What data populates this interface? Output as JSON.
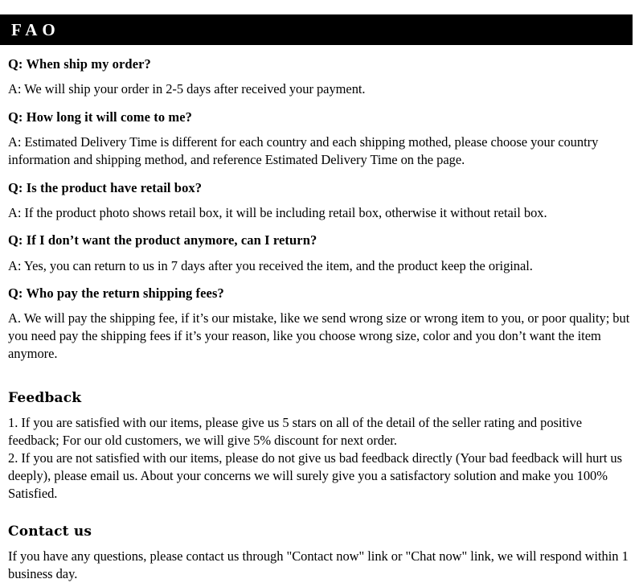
{
  "header": {
    "title": "FAO",
    "background_color": "#000000",
    "text_color": "#ffffff"
  },
  "faq": {
    "items": [
      {
        "question": "Q: When ship my order?",
        "answer": "A: We will ship your order in 2-5 days after received your payment."
      },
      {
        "question": "Q: How long it will come to me?",
        "answer": "A: Estimated Delivery Time is different for each country and each shipping mothed, please choose your country information and shipping method, and reference Estimated Delivery Time on the page."
      },
      {
        "question": "Q: Is the product have retail box?",
        "answer": "A: If  the product photo shows retail box, it will be including retail box, otherwise it without retail box."
      },
      {
        "question": "Q: If I don’t want the product anymore, can I return?",
        "answer": "A: Yes, you can return to us in 7 days after you received the item, and the product keep the original."
      },
      {
        "question": "Q: Who pay the return shipping fees?",
        "answer": "A. We will pay the shipping fee, if  it’s our mistake, like we send wrong size or wrong item to you, or poor quality; but you need pay the shipping fees if  it’s your reason, like you choose wrong size, color and you don’t want the item anymore."
      }
    ]
  },
  "feedback": {
    "heading": "Feedback",
    "item_1": "1.  If you are satisfied with our items, please give us 5 stars on all of the detail of the seller rating and positive feedback; For our old customers, we will give 5% discount for next order.",
    "item_2": "2.  If you are not satisfied with our items, please do not give us bad feedback directly (Your bad feedback will hurt us deeply), please email us. About your concerns we will surely give you a satisfactory solution and make you 100% Satisfied."
  },
  "contact": {
    "heading": "Contact us",
    "body": "If you have any questions, please contact us through \"Contact now\" link or \"Chat now\" link, we will respond within 1 business day."
  }
}
